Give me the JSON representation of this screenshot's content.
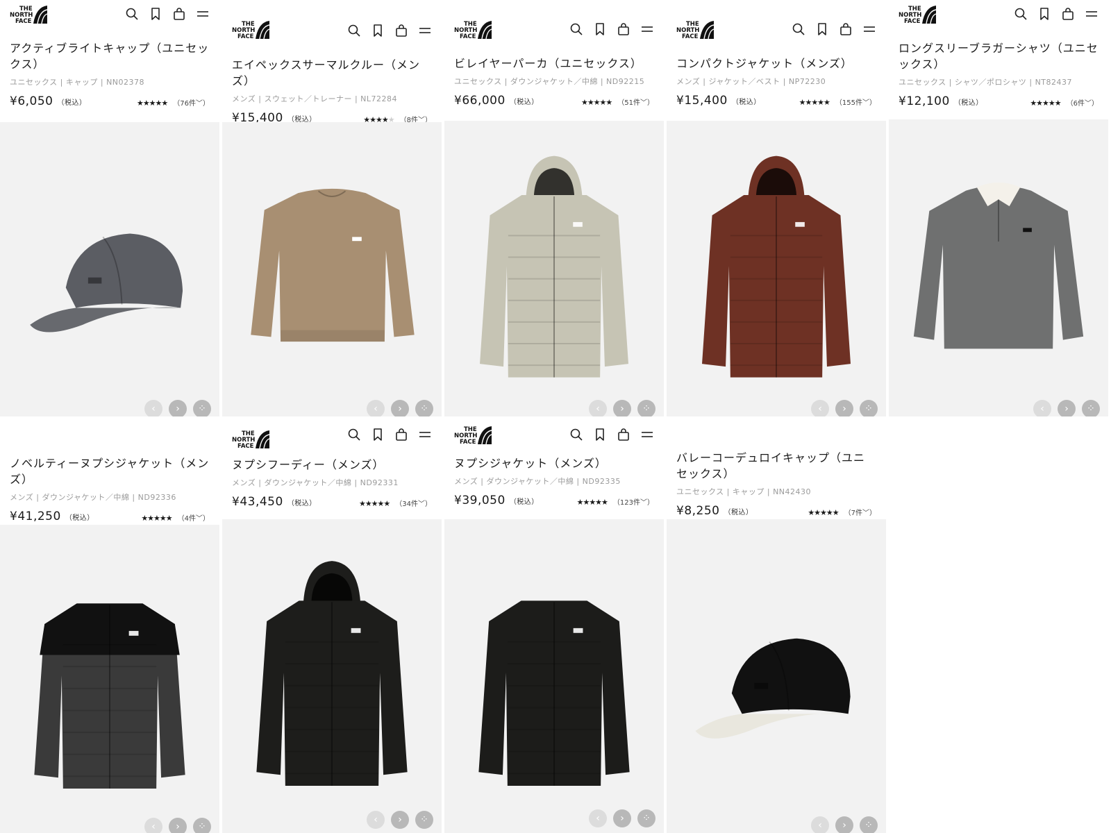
{
  "brand": {
    "logo_text": "THE NORTH FACE"
  },
  "header_icons": [
    "search-icon",
    "bookmark-icon",
    "cart-icon",
    "menu-icon"
  ],
  "products": [
    {
      "id": "p1",
      "name": "アクティブライトキャップ（ユニセックス）",
      "meta": "ユニセックス | キャップ | NN02378",
      "price": "¥6,050",
      "tax": "（税込）",
      "stars": 5,
      "reviews": "（76件﹀）",
      "color": "#5b5d63"
    },
    {
      "id": "p2",
      "name": "エイペックスサーマルクルー（メンズ）",
      "meta": "メンズ | スウェット／トレーナー | NL72284",
      "price": "¥15,400",
      "tax": "（税込）",
      "stars": 4,
      "reviews": "（8件﹀）",
      "color": "#a88f72"
    },
    {
      "id": "p3",
      "name": "ビレイヤーパーカ（ユニセックス）",
      "meta": "ユニセックス | ダウンジャケット／中綿 | ND92215",
      "price": "¥66,000",
      "tax": "（税込）",
      "stars": 5,
      "reviews": "（51件﹀）",
      "color": "#c6c4b4"
    },
    {
      "id": "p4",
      "name": "コンパクトジャケット（メンズ）",
      "meta": "メンズ | ジャケット／ベスト | NP72230",
      "price": "¥15,400",
      "tax": "（税込）",
      "stars": 5,
      "reviews": "（155件﹀）",
      "color": "#6e3124"
    },
    {
      "id": "p5",
      "name": "ロングスリーブラガーシャツ（ユニセックス）",
      "meta": "ユニセックス | シャツ／ポロシャツ | NT82437",
      "price": "¥12,100",
      "tax": "（税込）",
      "stars": 5,
      "reviews": "（6件﹀）",
      "color": "#6f7070"
    },
    {
      "id": "p6",
      "name": "ノベルティーヌプシジャケット（メンズ）",
      "meta": "メンズ | ダウンジャケット／中綿 | ND92336",
      "price": "¥41,250",
      "tax": "（税込）",
      "stars": 5,
      "reviews": "（4件﹀）",
      "color": "#2b2b2b"
    },
    {
      "id": "p7",
      "name": "ヌプシフーディー（メンズ）",
      "meta": "メンズ | ダウンジャケット／中綿 | ND92331",
      "price": "¥43,450",
      "tax": "（税込）",
      "stars": 5,
      "reviews": "（34件﹀）",
      "color": "#1d1d1b"
    },
    {
      "id": "p8",
      "name": "ヌプシジャケット（メンズ）",
      "meta": "メンズ | ダウンジャケット／中綿 | ND92335",
      "price": "¥39,050",
      "tax": "（税込）",
      "stars": 5,
      "reviews": "（123件﹀）",
      "color": "#1c1c1a"
    },
    {
      "id": "p9",
      "name": "バレーコーデュロイキャップ（ユニセックス）",
      "meta": "ユニセックス | キャップ | NN42430",
      "price": "¥8,250",
      "tax": "（税込）",
      "stars": 5,
      "reviews": "（7件﹀）",
      "color": "#111111"
    }
  ],
  "carousel": {
    "prev": "‹",
    "next": "›",
    "grid": "⁘"
  }
}
